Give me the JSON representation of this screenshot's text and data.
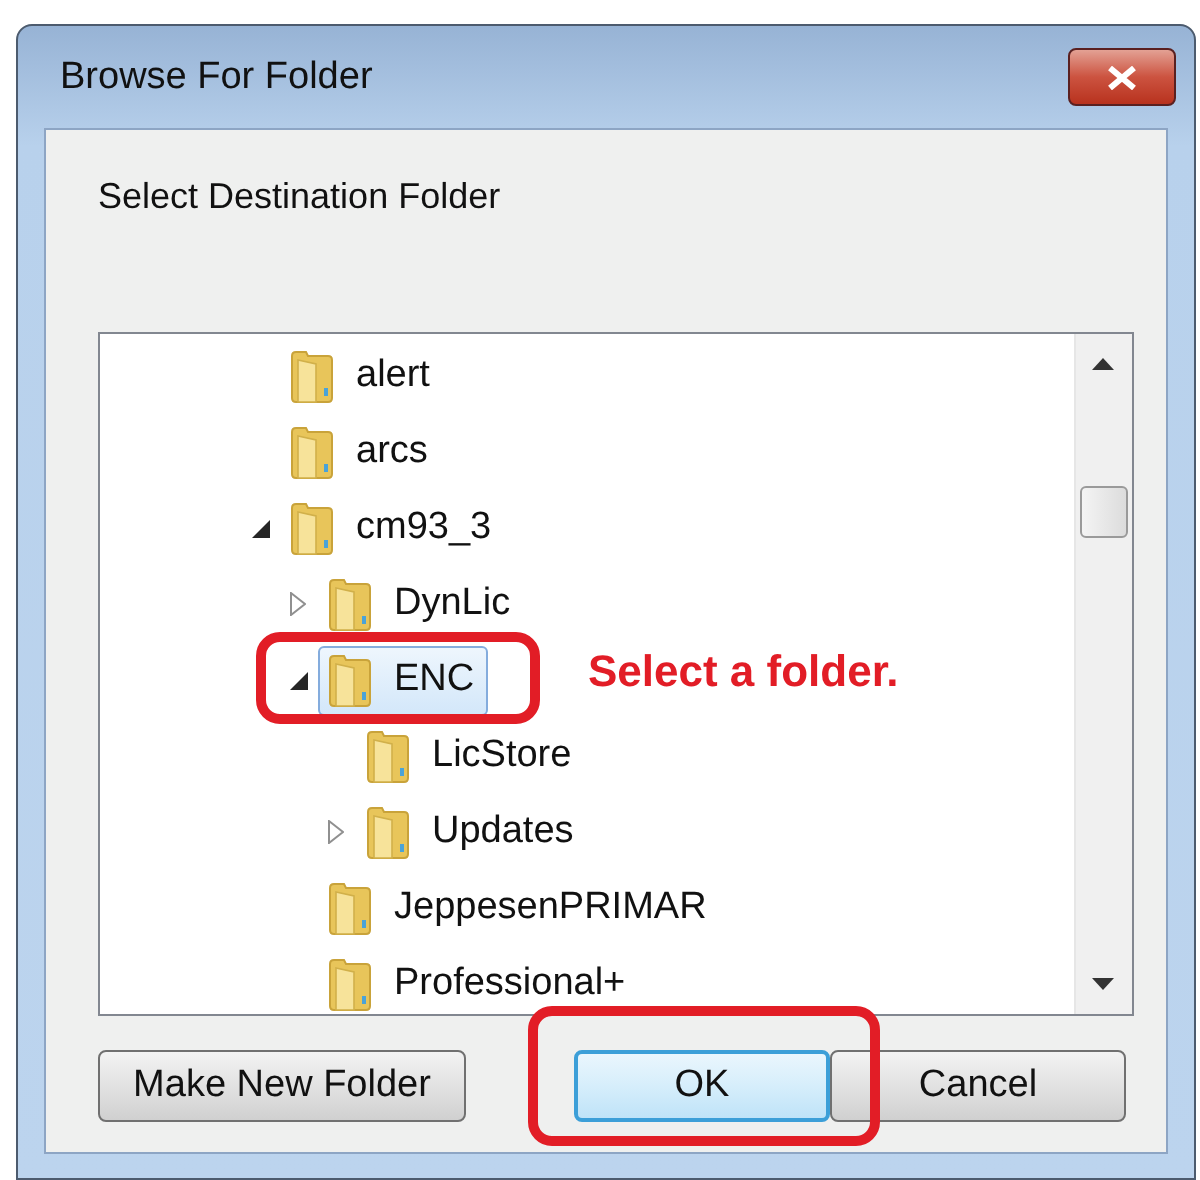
{
  "window": {
    "title": "Browse For Folder"
  },
  "prompt": "Select Destination Folder",
  "tree": [
    {
      "label": "alert",
      "selected": false
    },
    {
      "label": "arcs",
      "selected": false
    },
    {
      "label": "cm93_3",
      "expanded": true,
      "selected": false,
      "children": [
        {
          "label": "DynLic",
          "expanded": false,
          "selected": false
        },
        {
          "label": "ENC",
          "expanded": true,
          "selected": true,
          "children": [
            {
              "label": "LicStore",
              "selected": false
            },
            {
              "label": "Updates",
              "expanded": false,
              "selected": false
            }
          ]
        },
        {
          "label": "JeppesenPRIMAR",
          "selected": false
        },
        {
          "label": "Professional+",
          "selected": false
        }
      ]
    }
  ],
  "buttons": [
    {
      "label": "Make New Folder",
      "default": false
    },
    {
      "label": "OK",
      "default": true
    },
    {
      "label": "Cancel",
      "default": false
    }
  ],
  "annotation": {
    "text": "Select a folder."
  }
}
